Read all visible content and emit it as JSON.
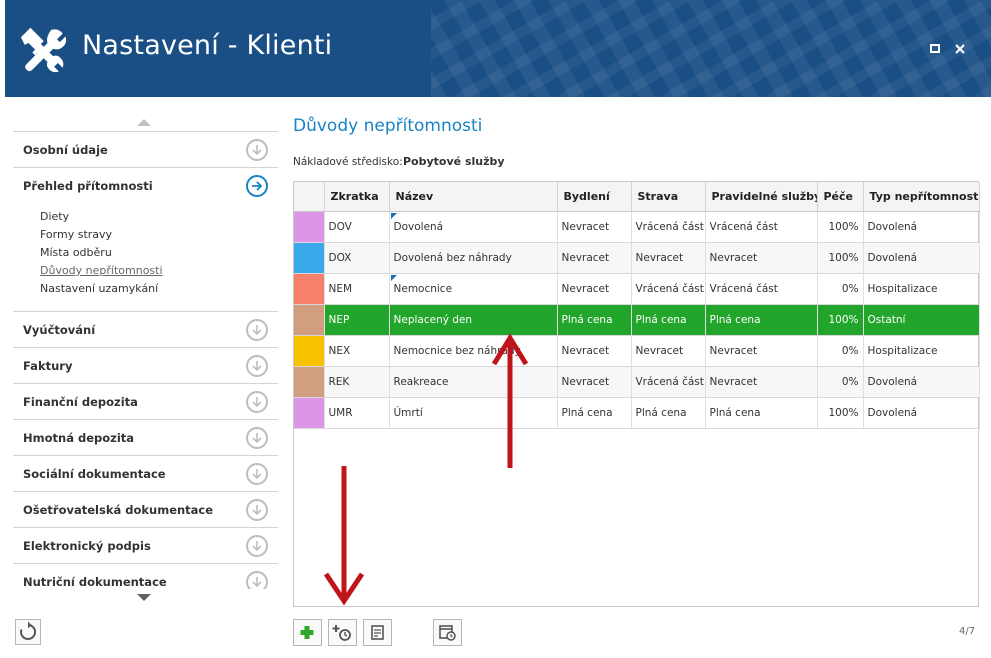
{
  "window": {
    "title": "Nastavení - Klienti"
  },
  "sidebar": {
    "items": [
      {
        "label": "Osobní údaje"
      },
      {
        "label": "Přehled přítomnosti"
      },
      {
        "label": "Vyúčtování"
      },
      {
        "label": "Faktury"
      },
      {
        "label": "Finanční depozita"
      },
      {
        "label": "Hmotná depozita"
      },
      {
        "label": "Sociální dokumentace"
      },
      {
        "label": "Ošetřovatelská dokumentace"
      },
      {
        "label": "Elektronický podpis"
      },
      {
        "label": "Nutriční dokumentace"
      }
    ],
    "subitems": [
      {
        "label": "Diety"
      },
      {
        "label": "Formy stravy"
      },
      {
        "label": "Místa odběru"
      },
      {
        "label": "Důvody nepřítomnosti"
      },
      {
        "label": "Nastavení uzamykání"
      }
    ]
  },
  "main": {
    "title": "Důvody nepřítomnosti",
    "cost_center_label": "Nákladové středisko:",
    "cost_center_value": "Pobytové služby",
    "columns": [
      "Zkratka",
      "Název",
      "Bydlení",
      "Strava",
      "Pravidelné služby",
      "Péče",
      "Typ nepřítomnosti"
    ],
    "rows": [
      {
        "color": "#dd95e8",
        "code": "DOV",
        "name": "Dovolená",
        "housing": "Nevracet",
        "food": "Vrácená část",
        "services": "Vrácená část",
        "care": "100%",
        "type": "Dovolená",
        "flag": true
      },
      {
        "color": "#3aa8ea",
        "code": "DOX",
        "name": "Dovolená bez náhrady",
        "housing": "Nevracet",
        "food": "Nevracet",
        "services": "Nevracet",
        "care": "100%",
        "type": "Dovolená",
        "flag": false
      },
      {
        "color": "#f7806a",
        "code": "NEM",
        "name": "Nemocnice",
        "housing": "Nevracet",
        "food": "Vrácená část",
        "services": "Vrácená část",
        "care": "0%",
        "type": "Hospitalizace",
        "flag": true
      },
      {
        "color": "#cf9f7f",
        "code": "NEP",
        "name": "Neplacený den",
        "housing": "Plná cena",
        "food": "Plná cena",
        "services": "Plná cena",
        "care": "100%",
        "type": "Ostatní",
        "flag": false,
        "selected": true
      },
      {
        "color": "#f7c200",
        "code": "NEX",
        "name": "Nemocnice bez náhrady",
        "housing": "Nevracet",
        "food": "Nevracet",
        "services": "Nevracet",
        "care": "0%",
        "type": "Hospitalizace",
        "flag": false
      },
      {
        "color": "#cf9f7f",
        "code": "REK",
        "name": "Reakreace",
        "housing": "Nevracet",
        "food": "Vrácená část",
        "services": "Nevracet",
        "care": "0%",
        "type": "Dovolená",
        "flag": false
      },
      {
        "color": "#dd95e8",
        "code": "UMR",
        "name": "Úmrtí",
        "housing": "Plná cena",
        "food": "Plná cena",
        "services": "Plná cena",
        "care": "100%",
        "type": "Dovolená",
        "flag": false
      }
    ],
    "pager": "4/7"
  },
  "colors": {
    "header_bg": "#1a4f86",
    "accent": "#1a83c6",
    "selected_row": "#21a52a",
    "annotation_arrow": "#c0141b"
  },
  "icons": {
    "app": "tools-icon",
    "add": "plus-icon",
    "add_time": "add-clock-icon",
    "notes": "notes-icon",
    "history": "calendar-clock-icon",
    "refresh": "refresh-icon"
  }
}
